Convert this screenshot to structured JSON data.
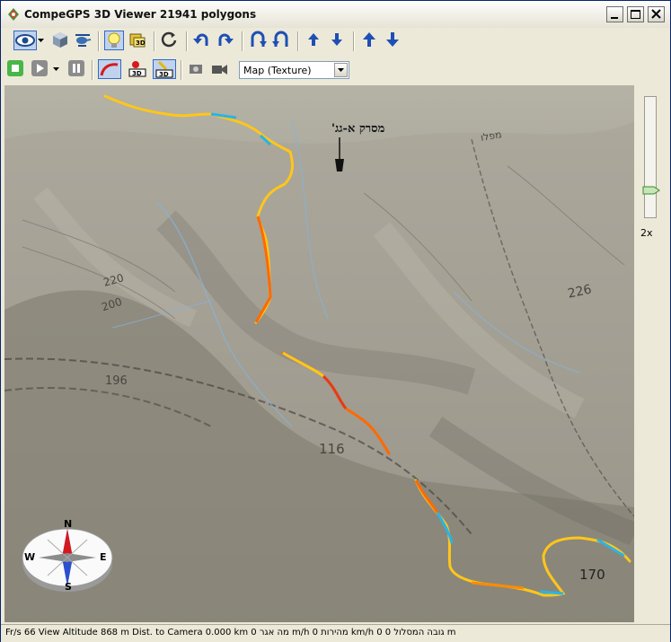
{
  "window": {
    "title": "CompeGPS 3D Viewer  21941 polygons"
  },
  "toolbar1": {
    "buttons": [
      {
        "name": "view-eye-icon",
        "active": true
      },
      {
        "name": "dropdown-arrow-icon"
      },
      {
        "name": "cube-icon"
      },
      {
        "name": "helicopter-icon"
      },
      {
        "name": "lightbulb-icon",
        "active": true
      },
      {
        "name": "3d-layers-icon"
      },
      {
        "name": "refresh-icon"
      },
      {
        "name": "rotate-left-icon"
      },
      {
        "name": "rotate-right-icon"
      },
      {
        "name": "tilt-up-icon"
      },
      {
        "name": "tilt-down-icon"
      },
      {
        "name": "arrow-up-icon"
      },
      {
        "name": "arrow-down-icon"
      },
      {
        "name": "altitude-up-icon"
      },
      {
        "name": "altitude-down-icon"
      }
    ]
  },
  "toolbar2": {
    "map_select": {
      "value": "Map (Texture)"
    }
  },
  "map": {
    "poi_label": "מסרק א-גג'",
    "elevations": [
      "220",
      "200",
      "196",
      "116",
      "226",
      "170"
    ],
    "top_label": "מפלו"
  },
  "zoom": {
    "label": "2x",
    "level": 0.2
  },
  "compass": {
    "n": "N",
    "s": "S",
    "e": "E",
    "w": "W"
  },
  "status": {
    "text": "Fr/s 66 View Altitude 868 m Dist. to Camera 0.000 km 0 מה אגר m/h 0 מהירות km/h 0 גובה המסלול 0 m"
  },
  "colors": {
    "track_warm": "#ff6a00",
    "track_yellow": "#ffc61a",
    "track_cool": "#28b4e6",
    "terrain": "#8e8b7f"
  }
}
